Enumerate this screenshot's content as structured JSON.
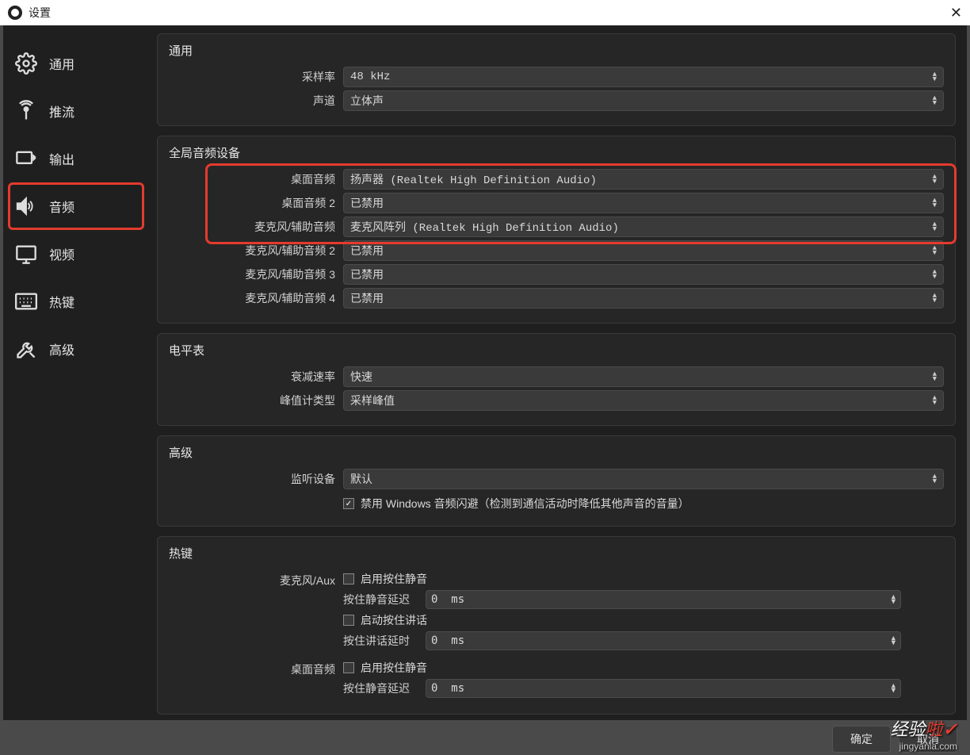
{
  "window": {
    "title": "设置"
  },
  "sidebar": {
    "items": [
      {
        "label": "通用"
      },
      {
        "label": "推流"
      },
      {
        "label": "输出"
      },
      {
        "label": "音频"
      },
      {
        "label": "视频"
      },
      {
        "label": "热键"
      },
      {
        "label": "高级"
      }
    ]
  },
  "groups": {
    "general": {
      "title": "通用",
      "sample_rate_label": "采样率",
      "sample_rate_value": "48 kHz",
      "channels_label": "声道",
      "channels_value": "立体声"
    },
    "devices": {
      "title": "全局音频设备",
      "desktop_audio_label": "桌面音频",
      "desktop_audio_value": "扬声器 (Realtek High Definition Audio)",
      "desktop_audio2_label": "桌面音频 2",
      "desktop_audio2_value": "已禁用",
      "mic1_label": "麦克风/辅助音频",
      "mic1_value": "麦克风阵列 (Realtek High Definition Audio)",
      "mic2_label": "麦克风/辅助音频 2",
      "mic2_value": "已禁用",
      "mic3_label": "麦克风/辅助音频 3",
      "mic3_value": "已禁用",
      "mic4_label": "麦克风/辅助音频 4",
      "mic4_value": "已禁用"
    },
    "meters": {
      "title": "电平表",
      "decay_label": "衰减速率",
      "decay_value": "快速",
      "peak_label": "峰值计类型",
      "peak_value": "采样峰值"
    },
    "advanced": {
      "title": "高级",
      "monitor_label": "监听设备",
      "monitor_value": "默认",
      "ducking_label": "禁用 Windows 音频闪避（检测到通信活动时降低其他声音的音量）"
    },
    "hotkeys": {
      "title": "热键",
      "mic_aux_label": "麦克风/Aux",
      "ptm_enable": "启用按住静音",
      "ptm_delay_label": "按住静音延迟",
      "ptm_delay_value": "0",
      "ms_unit": "ms",
      "ptt_enable": "启动按住讲话",
      "ptt_delay_label": "按住讲话延时",
      "ptt_delay_value": "0",
      "desktop_label": "桌面音频",
      "d_ptm_enable": "启用按住静音",
      "d_ptm_delay_label": "按住静音延迟",
      "d_ptm_delay_value": "0"
    }
  },
  "footer": {
    "ok": "确定",
    "cancel": "取消"
  },
  "watermark": {
    "text_a": "经验",
    "text_b": "啦",
    "check": "✓",
    "url": "jingyanla.com"
  }
}
